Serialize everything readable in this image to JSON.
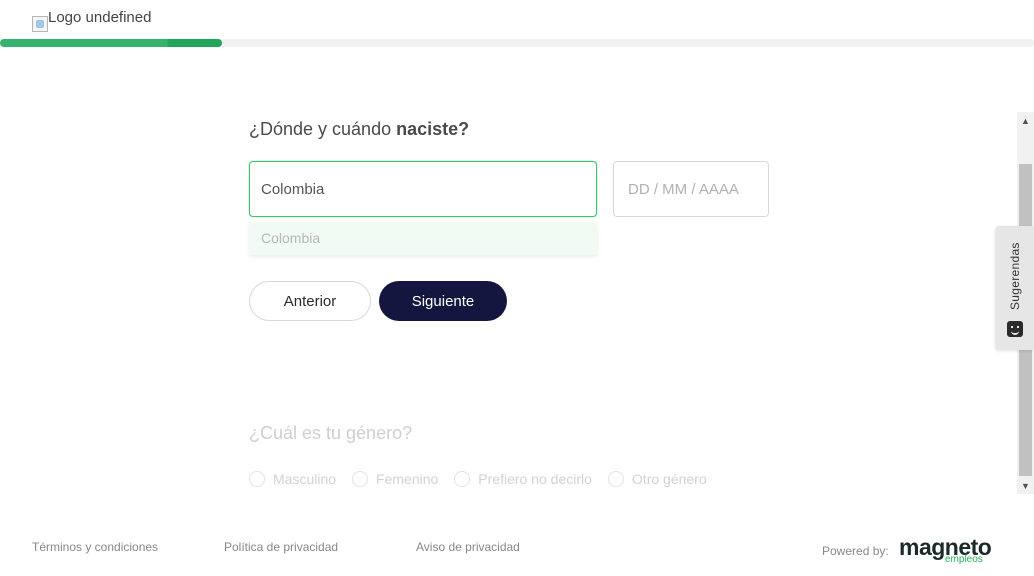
{
  "header": {
    "logo_alt": "Logo undefined",
    "progress_percent": 21.5
  },
  "form": {
    "birth": {
      "question_prefix": "¿Dónde y cuándo ",
      "question_bold": "naciste?",
      "country_value": "Colombia",
      "date_placeholder": "DD / MM / AAAA",
      "suggestions": [
        "Colombia"
      ]
    },
    "buttons": {
      "previous": "Anterior",
      "next": "Siguiente"
    },
    "gender": {
      "question": "¿Cuál es tu género?",
      "options": [
        "Masculino",
        "Femenino",
        "Prefiero no decirlo",
        "Otro género"
      ]
    }
  },
  "side_tab": {
    "label": "Sugerendas",
    "icon": "smiley-icon"
  },
  "footer": {
    "links": [
      "Términos y condiciones",
      "Política de privacidad",
      "Aviso de privacidad"
    ],
    "powered_by": "Powered by:",
    "brand_main": "magneto",
    "brand_sub": "empleos"
  },
  "colors": {
    "accent_green": "#35b36e",
    "primary_button": "#15163f",
    "input_focus_border": "#3ec46d"
  }
}
